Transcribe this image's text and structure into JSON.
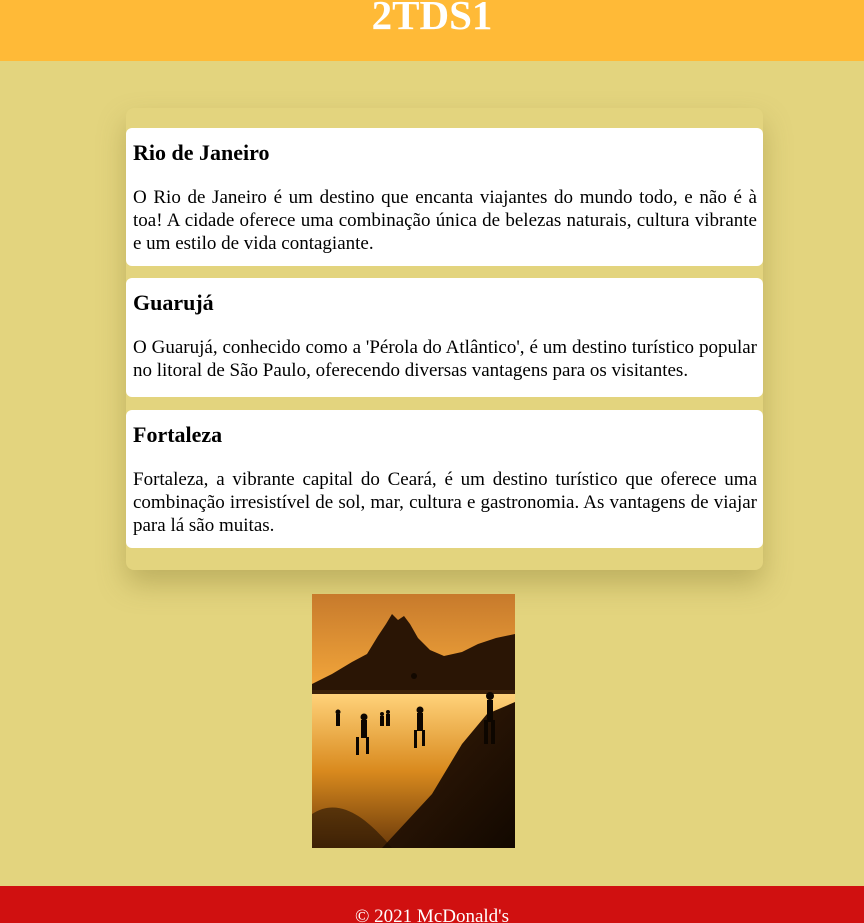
{
  "header": {
    "title": "2TDS1"
  },
  "cards": [
    {
      "title": "Rio de Janeiro",
      "text": "O Rio de Janeiro é um destino que encanta viajantes do mundo todo, e não é à toa! A cidade oferece uma combinação única de belezas naturais, cultura vibrante e um estilo de vida contagiante."
    },
    {
      "title": "Guarujá",
      "text": "O Guarujá, conhecido como a 'Pérola do Atlântico', é um destino turístico popular no litoral de São Paulo, oferecendo diversas vantagens para os visitantes."
    },
    {
      "title": "Fortaleza",
      "text": "Fortaleza, a vibrante capital do Ceará, é um destino turístico que oferece uma combinação irresistível de sol, mar, cultura e gastronomia. As vantagens de viajar para lá são muitas."
    }
  ],
  "photo": {
    "icon": "beach-sunset-photo"
  },
  "footer": {
    "text": "© 2021 McDonald's"
  },
  "colors": {
    "background": "#e3d47e",
    "header": "#ffba37",
    "footer": "#d01010"
  }
}
